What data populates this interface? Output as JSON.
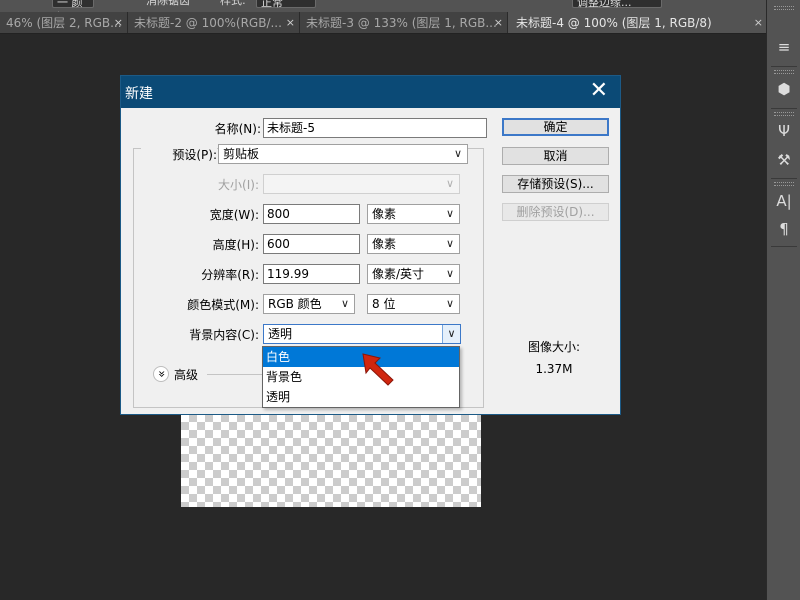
{
  "app": {
    "options_bar": {
      "chip_a": "一 颜素",
      "text_b": "消除锯齿",
      "text_c": "样式:",
      "chip_c": "正常",
      "chip_d": "调整边缘..."
    },
    "tabs": [
      {
        "label": "46% (图层 2, RGB...",
        "active": false
      },
      {
        "label": "未标题-2 @ 100%(RGB/...",
        "active": false
      },
      {
        "label": "未标题-3 @ 133% (图层 1, RGB...",
        "active": false
      },
      {
        "label": "未标题-4 @ 100% (图层 1, RGB/8)",
        "active": true
      }
    ],
    "close_glyph": "×",
    "right_panel_icons": [
      "layers-icon",
      "3d-cube-icon",
      "brush-icon",
      "tool-presets-icon",
      "character-icon",
      "paragraph-icon"
    ],
    "right_panel_glyphs": {
      "character": "A|",
      "paragraph": "¶",
      "layers": "≡",
      "cube": "⬢",
      "brush": "Ψ",
      "tools": "⚒"
    }
  },
  "dialog": {
    "title": "新建",
    "close_glyph": "✕",
    "fields": {
      "name": {
        "label": "名称(N):",
        "value": "未标题-5"
      },
      "preset": {
        "label": "预设(P):",
        "value": "剪贴板"
      },
      "size": {
        "label": "大小(I):",
        "value": ""
      },
      "width": {
        "label": "宽度(W):",
        "value": "800",
        "unit": "像素"
      },
      "height": {
        "label": "高度(H):",
        "value": "600",
        "unit": "像素"
      },
      "resolution": {
        "label": "分辨率(R):",
        "value": "119.99",
        "unit": "像素/英寸"
      },
      "color_mode": {
        "label": "颜色模式(M):",
        "value": "RGB 颜色",
        "depth": "8 位"
      },
      "background": {
        "label": "背景内容(C):",
        "value": "透明"
      }
    },
    "advanced_label": "高级",
    "advanced_glyph": "»",
    "buttons": {
      "ok": "确定",
      "cancel": "取消",
      "save_preset": "存储预设(S)...",
      "delete_preset": "删除预设(D)..."
    },
    "image_size": {
      "label": "图像大小:",
      "value": "1.37M"
    },
    "background_options": [
      "白色",
      "背景色",
      "透明"
    ],
    "selected_option_index": 0,
    "dropdown_arrow": "∨"
  },
  "colors": {
    "title_bar": "#0b4a76",
    "selection": "#0078d7",
    "pointer": "#d0260f"
  }
}
